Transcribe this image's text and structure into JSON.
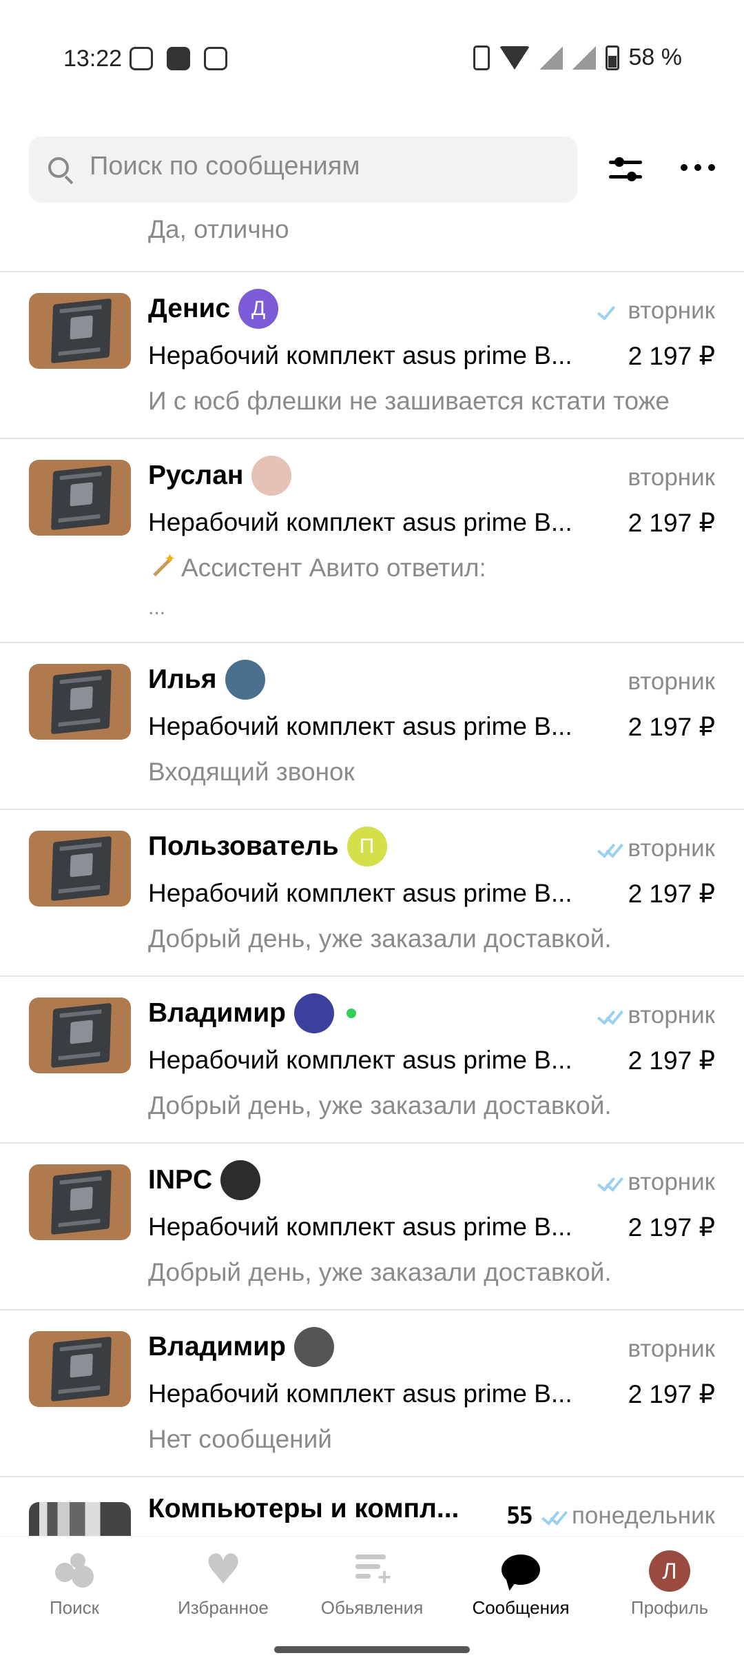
{
  "status_bar": {
    "time": "13:22",
    "battery": "58 %"
  },
  "search": {
    "placeholder": "Поиск по сообщениям"
  },
  "partial_previous_preview": "Да, отлично",
  "chats": [
    {
      "name": "Денис",
      "avatar_letter": "Д",
      "avatar_color": "#7b5bd6",
      "date": "вторник",
      "read_status": "single-check",
      "item": "Нерабочий комплект asus prime B...",
      "price": "2 197 ₽",
      "preview": "И с юсб флешки не зашивается кстати тоже"
    },
    {
      "name": "Руслан",
      "avatar_letter": "",
      "avatar_color": "#e6c2b6",
      "date": "вторник",
      "read_status": "none",
      "item": "Нерабочий комплект asus prime B...",
      "price": "2 197 ₽",
      "preview": "Ассистент Авито ответил:",
      "preview_extra": "..."
    },
    {
      "name": "Илья",
      "avatar_letter": "",
      "avatar_color": "#4a6f8f",
      "date": "вторник",
      "read_status": "none",
      "item": "Нерабочий комплект asus prime B...",
      "price": "2 197 ₽",
      "preview": "Входящий звонок"
    },
    {
      "name": "Пользователь",
      "avatar_letter": "П",
      "avatar_color": "#d4e04a",
      "date": "вторник",
      "read_status": "double-check",
      "item": "Нерабочий комплект asus prime B...",
      "price": "2 197 ₽",
      "preview": "Добрый день, уже заказали доставкой."
    },
    {
      "name": "Владимир",
      "avatar_letter": "",
      "avatar_color": "#3b3f9e",
      "online": true,
      "date": "вторник",
      "read_status": "double-check",
      "item": "Нерабочий комплект asus prime B...",
      "price": "2 197 ₽",
      "preview": "Добрый день, уже заказали доставкой."
    },
    {
      "name": "INPC",
      "avatar_letter": "",
      "avatar_color": "#2c2c2c",
      "date": "вторник",
      "read_status": "double-check",
      "item": "Нерабочий комплект asus prime B...",
      "price": "2 197 ₽",
      "preview": "Добрый день, уже заказали доставкой."
    },
    {
      "name": "Владимир",
      "avatar_letter": "",
      "avatar_color": "#555555",
      "date": "вторник",
      "read_status": "none",
      "item": "Нерабочий комплект asus prime B...",
      "price": "2 197 ₽",
      "preview": "Нет сообщений"
    },
    {
      "name": "Компьютеры и компл...",
      "badge": "55",
      "date": "понедельник",
      "read_status": "double-check"
    }
  ],
  "bottom_nav": [
    {
      "label": "Поиск",
      "icon": "search-dots-icon"
    },
    {
      "label": "Избранное",
      "icon": "heart-icon"
    },
    {
      "label": "Обьявления",
      "icon": "listings-add-icon"
    },
    {
      "label": "Сообщения",
      "icon": "chat-bubble-icon",
      "active": true
    },
    {
      "label": "Профиль",
      "icon": "profile-avatar-icon",
      "avatar_letter": "Л",
      "avatar_color": "#9a4a3e"
    }
  ]
}
